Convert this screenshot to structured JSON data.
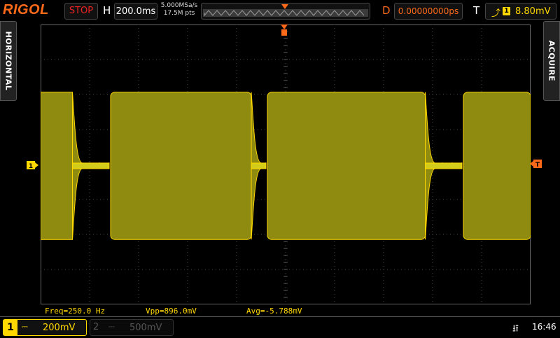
{
  "brand": "RIGOL",
  "status": "STOP",
  "horizontal": {
    "label": "H",
    "timebase": "200.0ms"
  },
  "sample": {
    "rate": "5.000MSa/s",
    "points": "17.5M pts"
  },
  "delay": {
    "label": "D",
    "value": "0.00000000ps"
  },
  "trigger": {
    "label": "T",
    "channel": "1",
    "level": "8.80mV",
    "edge_icon": "rising-edge-icon"
  },
  "side_tabs": {
    "left": "HORIZONTAL",
    "right": "ACQUIRE"
  },
  "markers": {
    "channel": "1",
    "trigger": "T"
  },
  "measurements": {
    "freq": "Freq=250.0 Hz",
    "vpp": "Vpp=896.0mV",
    "avg": "Avg=-5.788mV"
  },
  "channels": [
    {
      "num": "1",
      "coupling": "DC",
      "scale": "200mV",
      "color": "#ffd800",
      "active": true
    },
    {
      "num": "2",
      "coupling": "DC",
      "scale": "500mV",
      "color": "#555555",
      "active": false
    }
  ],
  "clock": "16:46",
  "colors": {
    "trace": "#ffd800",
    "accent": "#ff6a1a",
    "grid": "#555555"
  },
  "waveform": {
    "description_units": "divisions",
    "high_envelope_div": 2.6,
    "low_envelope_div": 0.1,
    "segments_div": [
      {
        "start": 0.0,
        "end": 0.65,
        "state": "high"
      },
      {
        "start": 0.65,
        "end": 1.4,
        "state": "low"
      },
      {
        "start": 1.4,
        "end": 4.3,
        "state": "high"
      },
      {
        "start": 4.3,
        "end": 4.6,
        "state": "low"
      },
      {
        "start": 4.6,
        "end": 7.85,
        "state": "high"
      },
      {
        "start": 7.85,
        "end": 8.6,
        "state": "low"
      },
      {
        "start": 8.6,
        "end": 10.0,
        "state": "high"
      }
    ]
  }
}
